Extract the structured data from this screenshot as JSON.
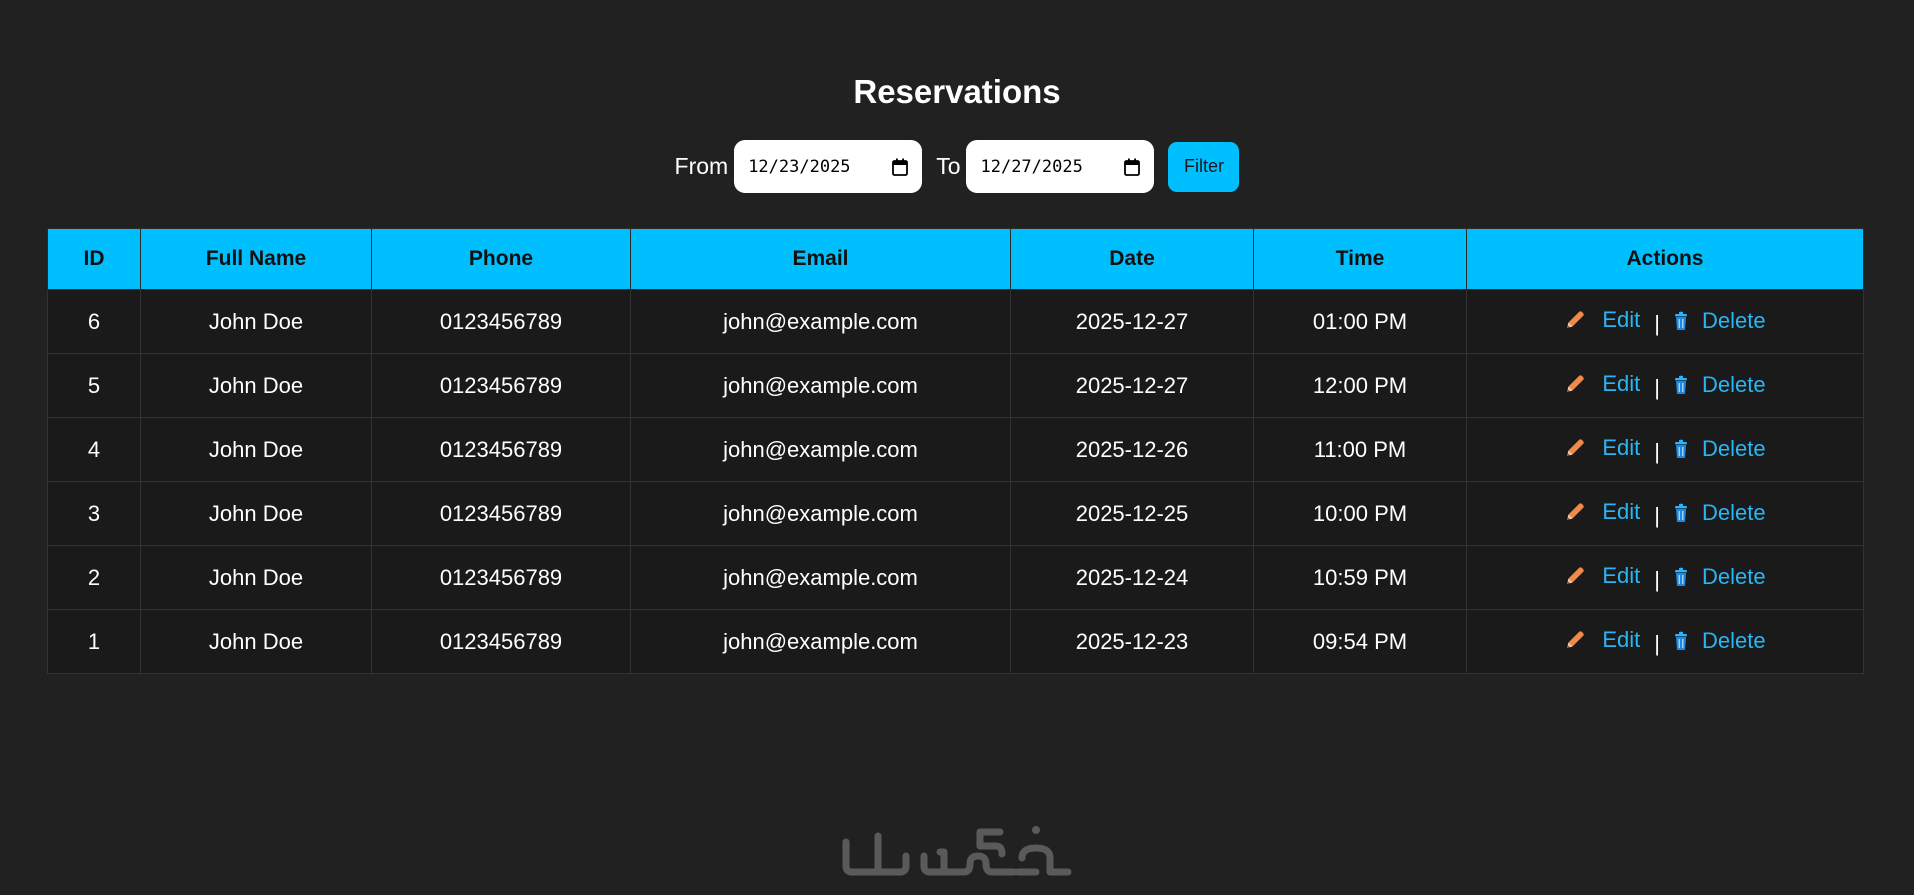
{
  "header": {
    "title": "Reservations"
  },
  "filter": {
    "from_label": "From",
    "from_value": "12/23/2025",
    "to_label": "To",
    "to_value": "12/27/2025",
    "button_label": "Filter"
  },
  "table": {
    "columns": [
      "ID",
      "Full Name",
      "Phone",
      "Email",
      "Date",
      "Time",
      "Actions"
    ],
    "rows": [
      {
        "id": "6",
        "name": "John Doe",
        "phone": "0123456789",
        "email": "john@example.com",
        "date": "2025-12-27",
        "time": "01:00 PM"
      },
      {
        "id": "5",
        "name": "John Doe",
        "phone": "0123456789",
        "email": "john@example.com",
        "date": "2025-12-27",
        "time": "12:00 PM"
      },
      {
        "id": "4",
        "name": "John Doe",
        "phone": "0123456789",
        "email": "john@example.com",
        "date": "2025-12-26",
        "time": "11:00 PM"
      },
      {
        "id": "3",
        "name": "John Doe",
        "phone": "0123456789",
        "email": "john@example.com",
        "date": "2025-12-25",
        "time": "10:00 PM"
      },
      {
        "id": "2",
        "name": "John Doe",
        "phone": "0123456789",
        "email": "john@example.com",
        "date": "2025-12-24",
        "time": "10:59 PM"
      },
      {
        "id": "1",
        "name": "John Doe",
        "phone": "0123456789",
        "email": "john@example.com",
        "date": "2025-12-23",
        "time": "09:54 PM"
      }
    ],
    "edit_label": "Edit",
    "delete_label": "Delete",
    "separator": "|"
  },
  "icons": {
    "edit": "pencil-icon",
    "delete": "trash-icon",
    "calendar": "calendar-icon"
  },
  "colors": {
    "background": "#212121",
    "accent": "#00bfff",
    "link": "#29b6f6",
    "pencil": "#f08a4b",
    "watermark": "#5a5a5a"
  },
  "watermark": {
    "logo": "خمسات"
  }
}
